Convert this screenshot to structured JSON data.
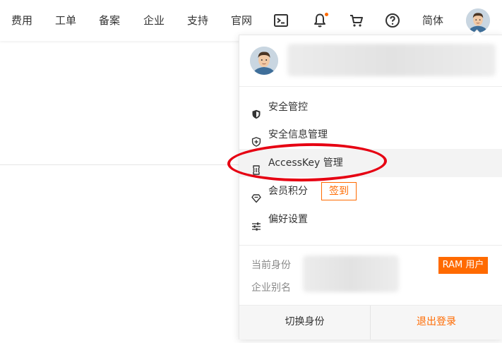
{
  "colors": {
    "accent": "#ff6a00",
    "annotation": "#e60012",
    "hover_bg": "#f3f3f3",
    "badge_bg": "#ff6a00"
  },
  "topnav": {
    "items": [
      {
        "label": "费用"
      },
      {
        "label": "工单"
      },
      {
        "label": "备案"
      },
      {
        "label": "企业"
      },
      {
        "label": "支持"
      },
      {
        "label": "官网"
      }
    ],
    "icons": [
      "terminal-icon",
      "bell-icon",
      "cart-icon",
      "help-icon"
    ],
    "language_label": "简体"
  },
  "dropdown": {
    "menu": [
      {
        "label": "安全管控",
        "icon": "shield-icon"
      },
      {
        "label": "安全信息管理",
        "icon": "shield-plus-icon"
      },
      {
        "label": "AccessKey 管理",
        "icon": "key-icon"
      },
      {
        "label": "会员积分",
        "icon": "diamond-icon",
        "action_label": "签到"
      },
      {
        "label": "偏好设置",
        "icon": "sliders-icon"
      }
    ],
    "identity": {
      "current_identity_label": "当前身份",
      "enterprise_alias_label": "企业别名",
      "badge": "RAM 用户"
    },
    "footer": {
      "switch_label": "切换身份",
      "logout_label": "退出登录"
    }
  }
}
